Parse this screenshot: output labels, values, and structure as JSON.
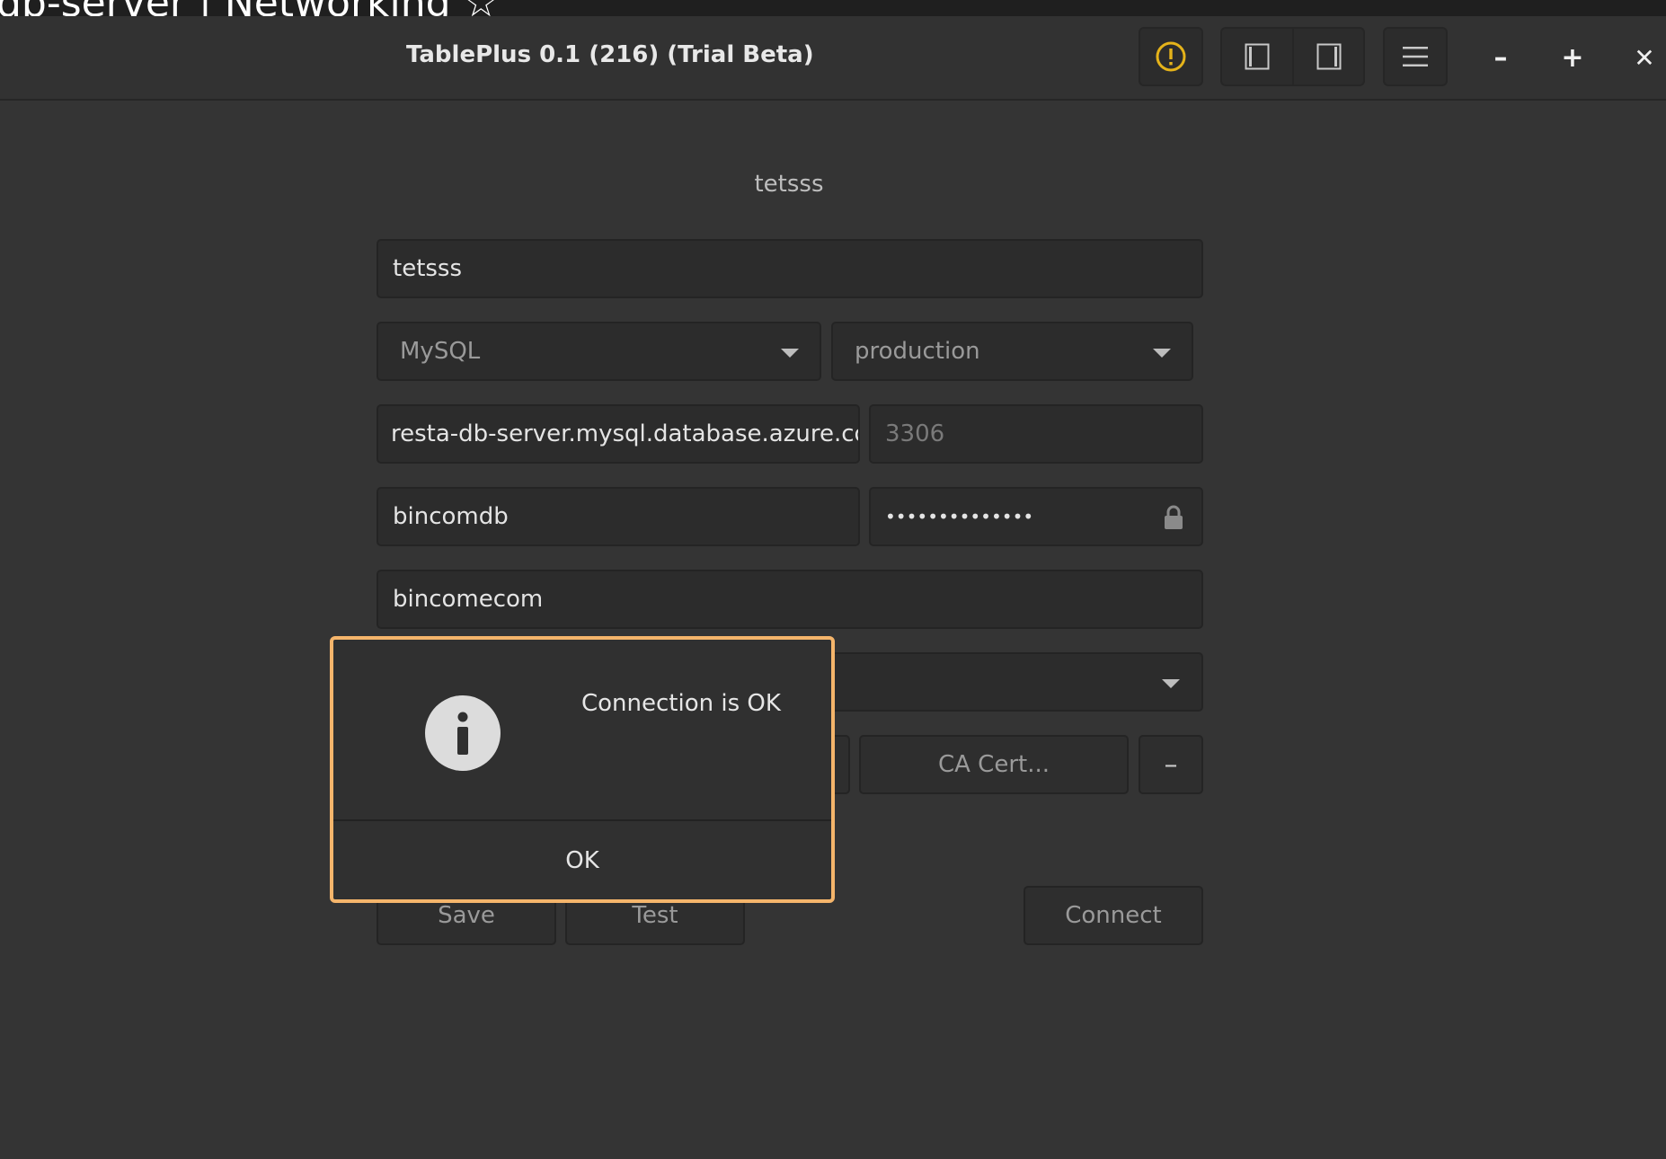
{
  "background_window_title": "db-server | Networking ☆",
  "window": {
    "title": "TablePlus 0.1 (216) (Trial Beta)",
    "controls": {
      "minimize": "–",
      "maximize": "+",
      "close": "✕"
    }
  },
  "form": {
    "header_name": "tetsss",
    "name": "tetsss",
    "driver": "MySQL",
    "environment": "production",
    "host": "resta-db-server.mysql.database.azure.com",
    "port_placeholder": "3306",
    "user": "bincomdb",
    "password_masked": "••••••••••••••",
    "database": "bincomecom",
    "ca_cert_label": "CA Cert...",
    "remove_label": "–",
    "save_label": "Save",
    "test_label": "Test",
    "connect_label": "Connect"
  },
  "dialog": {
    "message": "Connection is OK",
    "ok_label": "OK",
    "border_color": "#f5b56b"
  },
  "icons": {
    "warning": "warning-icon",
    "left_panel": "sidebar-left-icon",
    "right_panel": "sidebar-right-icon",
    "menu": "hamburger-menu-icon",
    "lock": "lock-icon",
    "info": "info-icon",
    "dropdown": "chevron-down-icon"
  },
  "colors": {
    "warning_accent": "#e5b31a",
    "dialog_border": "#f5b56b"
  }
}
